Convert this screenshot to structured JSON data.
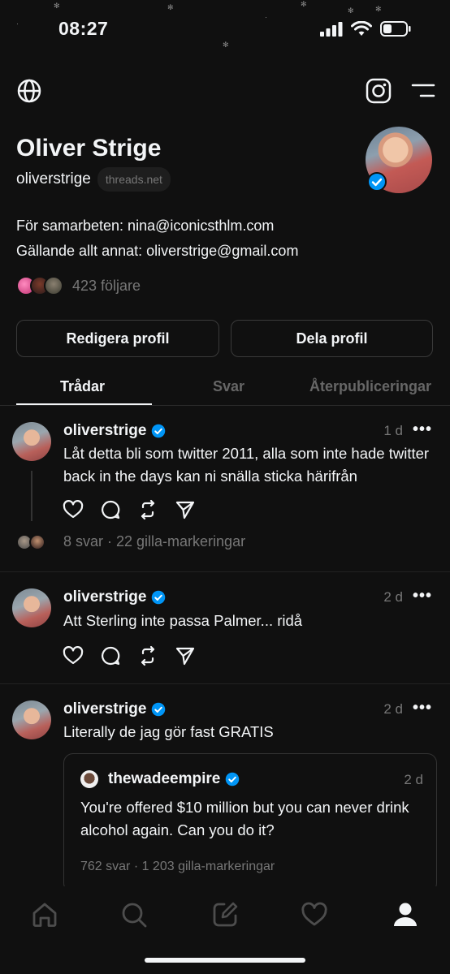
{
  "status_bar": {
    "time": "08:27"
  },
  "header_icons": [
    "globe-icon",
    "instagram-icon",
    "menu-icon"
  ],
  "profile": {
    "name": "Oliver Strige",
    "handle": "oliverstrige",
    "domain_badge": "threads.net",
    "verified": true,
    "bio_lines": [
      "För samarbeten: nina@iconicsthlm.com",
      "Gällande allt annat: oliverstrige@gmail.com"
    ],
    "followers": "423 följare"
  },
  "buttons": {
    "edit_profile": "Redigera profil",
    "share_profile": "Dela profil"
  },
  "tabs": [
    {
      "label": "Trådar",
      "active": true
    },
    {
      "label": "Svar",
      "active": false
    },
    {
      "label": "Återpubliceringar",
      "active": false
    }
  ],
  "posts": [
    {
      "username": "oliverstrige",
      "time": "1 d",
      "text": "Låt detta bli som twitter 2011, alla som inte hade twitter back in the days kan ni snälla sticka härifrån",
      "stats": "8 svar · 22 gilla-markeringar"
    },
    {
      "username": "oliverstrige",
      "time": "2 d",
      "text": "Att Sterling inte passa Palmer... ridå"
    },
    {
      "username": "oliverstrige",
      "time": "2 d",
      "text": "Literally de jag gör fast GRATIS",
      "quote": {
        "username": "thewadeempire",
        "time": "2 d",
        "text": "You're offered $10 million but you can never drink alcohol again. Can you do it?",
        "stats": "762 svar · 1 203 gilla-markeringar"
      }
    }
  ],
  "more_label": "•••",
  "colors": {
    "background": "#101010",
    "text": "#f3f5f7",
    "muted": "#777777",
    "verified": "#0095f6"
  }
}
